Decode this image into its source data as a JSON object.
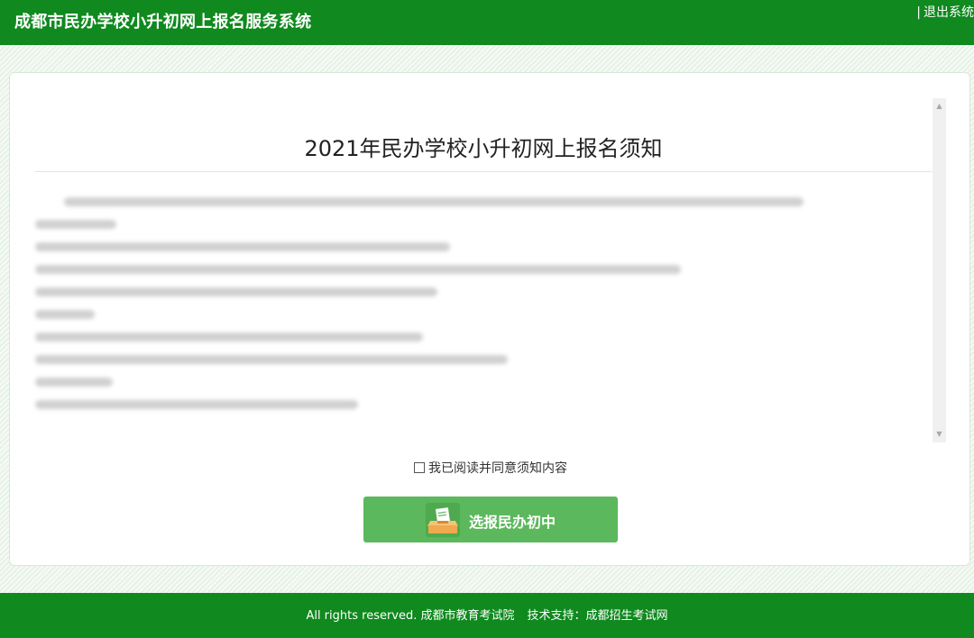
{
  "header": {
    "title": "成都市民办学校小升初网上报名服务系统",
    "logout_separator": "|",
    "logout_label": "退出系统"
  },
  "notice": {
    "title": "2021年民办学校小升初网上报名须知"
  },
  "agreement": {
    "checkbox_label": "我已阅读并同意须知内容",
    "checked": false
  },
  "actions": {
    "choose_button_label": "选报民办初中"
  },
  "footer": {
    "copyright": "All rights reserved. 成都市教育考试院",
    "support": "技术支持：成都招生考试网"
  },
  "colors": {
    "brand_green": "#10891f",
    "button_green": "#5cb85c"
  },
  "icons": {
    "button_icon": "ballot-box-icon"
  }
}
